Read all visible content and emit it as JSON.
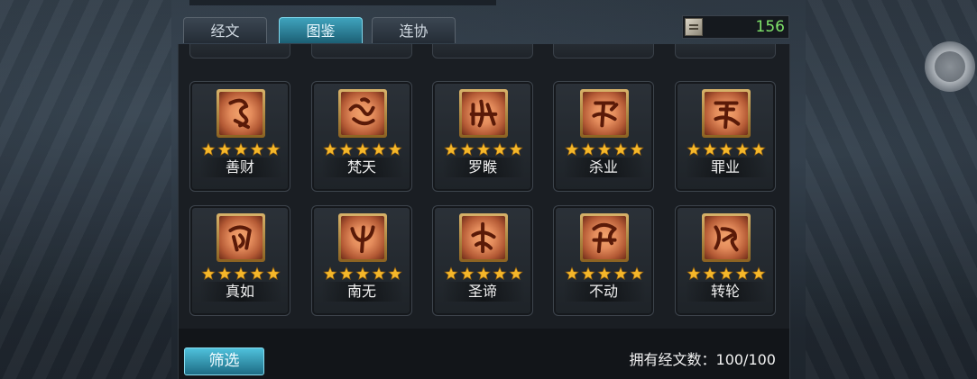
{
  "tabs": [
    {
      "label": "经文",
      "active": false
    },
    {
      "label": "图鉴",
      "active": true
    },
    {
      "label": "连协",
      "active": false
    }
  ],
  "currency": {
    "icon": "scroll-icon",
    "value": "156",
    "color": "#7fe36a"
  },
  "cards": [
    {
      "name": "善财",
      "stars": 5
    },
    {
      "name": "梵天",
      "stars": 5
    },
    {
      "name": "罗睺",
      "stars": 5
    },
    {
      "name": "杀业",
      "stars": 5
    },
    {
      "name": "罪业",
      "stars": 5
    },
    {
      "name": "真如",
      "stars": 5
    },
    {
      "name": "南无",
      "stars": 5
    },
    {
      "name": "圣谛",
      "stars": 5
    },
    {
      "name": "不动",
      "stars": 5
    },
    {
      "name": "转轮",
      "stars": 5
    }
  ],
  "footer": {
    "filter_label": "筛选",
    "owned_label": "拥有经文数：100/100"
  },
  "colors": {
    "accent": "#3fa3bd",
    "star": "#f5b72a",
    "icon_bg": "#e48c5c"
  }
}
